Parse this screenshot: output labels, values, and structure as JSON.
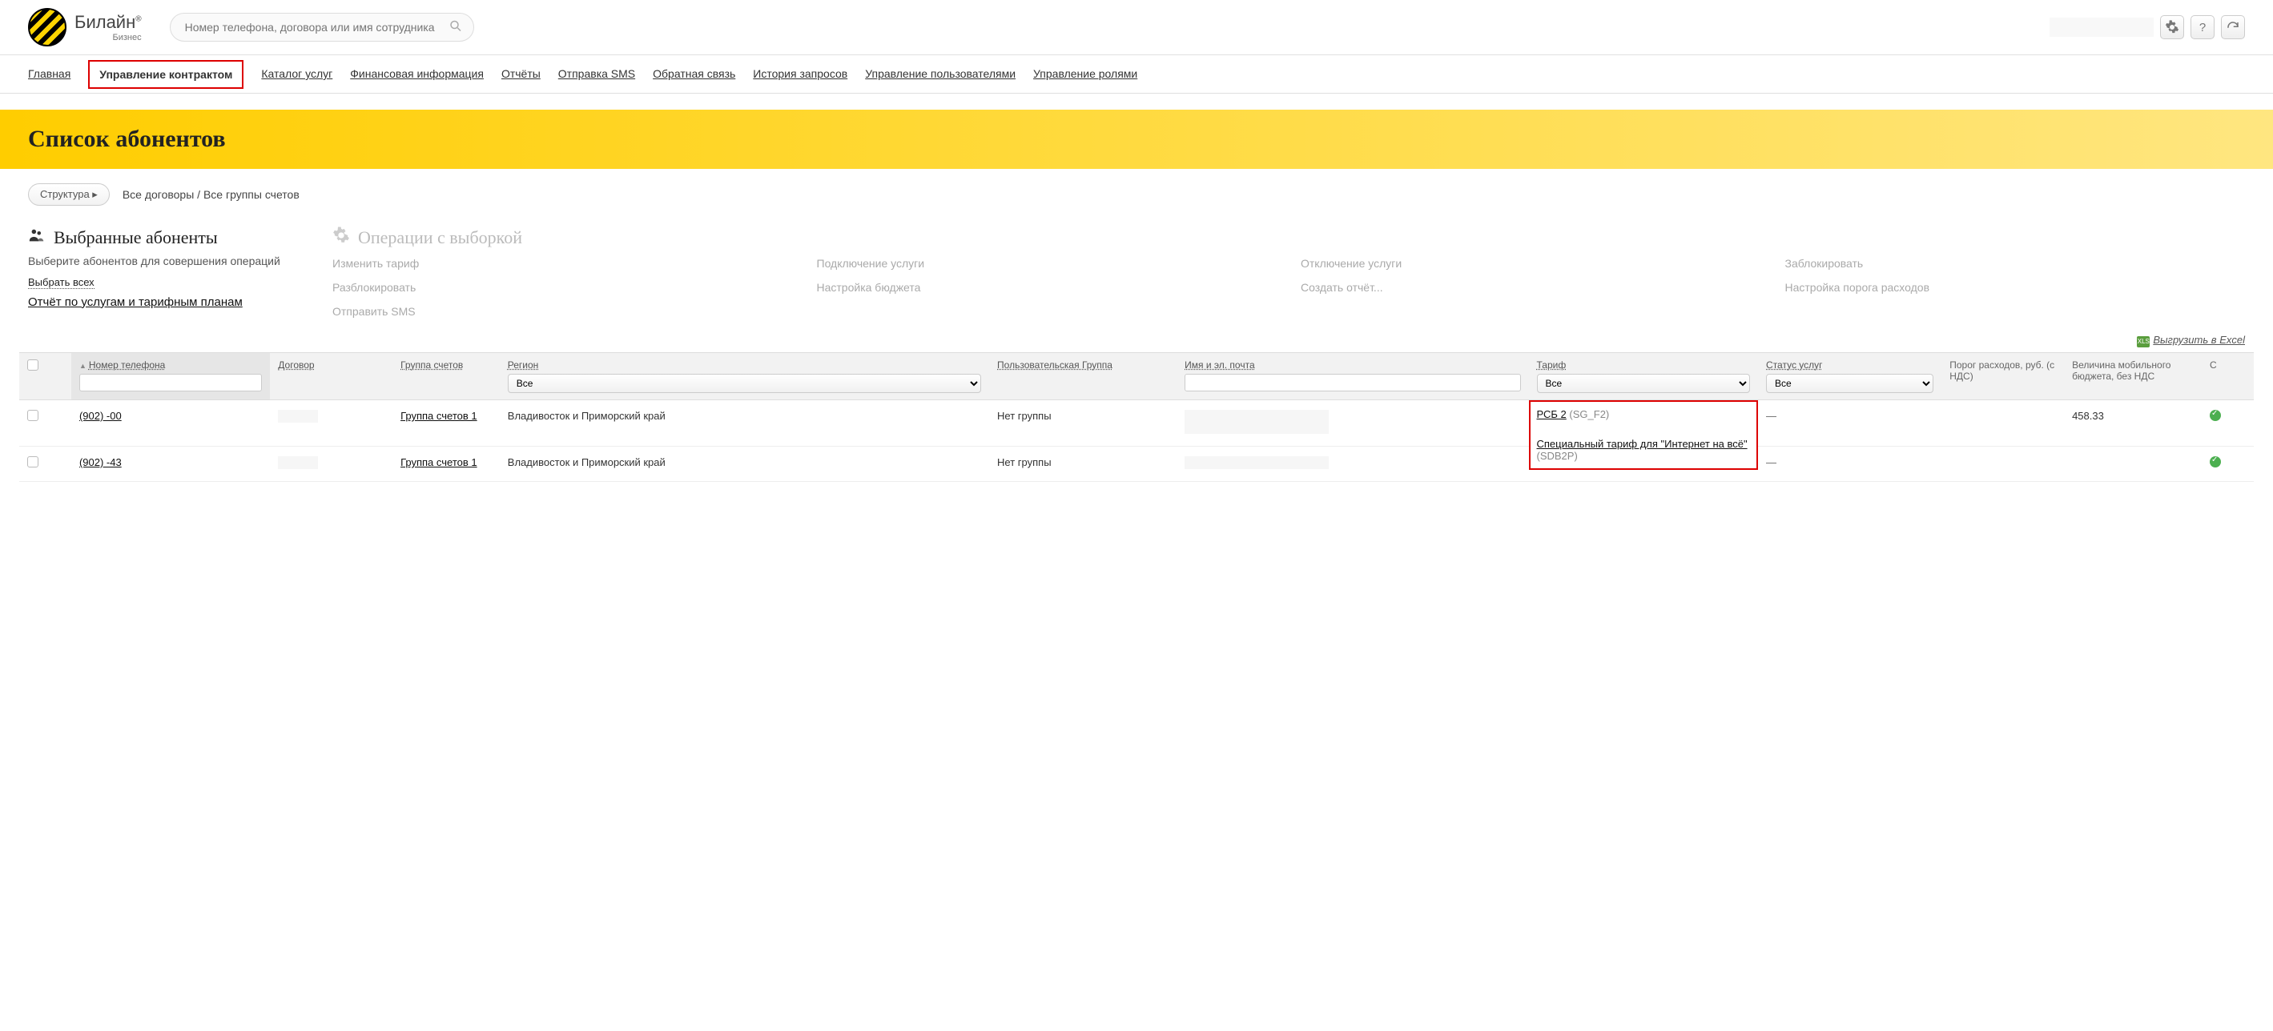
{
  "header": {
    "brand": "Билайн",
    "brand_sub": "Бизнес",
    "search_placeholder": "Номер телефона, договора или имя сотрудника"
  },
  "nav": {
    "items": [
      "Главная",
      "Управление контрактом",
      "Каталог услуг",
      "Финансовая информация",
      "Отчёты",
      "Отправка SMS",
      "Обратная связь",
      "История запросов",
      "Управление пользователями",
      "Управление ролями"
    ],
    "active_index": 1
  },
  "page": {
    "title": "Список абонентов",
    "structure_btn": "Структура ▸",
    "breadcrumb": "Все договоры  /  Все группы счетов"
  },
  "selection": {
    "title": "Выбранные абоненты",
    "desc": "Выберите абонентов для совершения операций",
    "select_all": "Выбрать всех",
    "report_link": "Отчёт по услугам и тарифным планам"
  },
  "operations": {
    "title": "Операции с выборкой",
    "items": [
      "Изменить тариф",
      "Подключение услуги",
      "Отключение услуги",
      "Заблокировать",
      "Разблокировать",
      "Настройка бюджета",
      "Создать отчёт...",
      "Настройка порога расходов",
      "Отправить SMS"
    ]
  },
  "export_label": "Выгрузить в Excel",
  "table": {
    "columns": {
      "phone": "Номер телефона",
      "contract": "Договор",
      "account_group": "Группа счетов",
      "region": "Регион",
      "user_group": "Пользовательская Группа",
      "name_email": "Имя и эл. почта",
      "tariff": "Тариф",
      "service_status": "Статус услуг",
      "spend_threshold": "Порог расходов, руб. (с НДС)",
      "budget": "Величина мобильного бюджета, без НДС",
      "last": "С"
    },
    "filter_all": "Все",
    "rows": [
      {
        "phone": "(902)          -00",
        "account_group": "Группа счетов 1",
        "region": "Владивосток и Приморский край",
        "user_group": "Нет группы",
        "tariff_name": "РСБ 2",
        "tariff_code": "(SG_F2)",
        "service_status": "—",
        "budget": "458.33"
      },
      {
        "phone": "(902)          -43",
        "account_group": "Группа счетов 1",
        "region": "Владивосток и Приморский край",
        "user_group": "Нет группы",
        "tariff_name": "Специальный тариф для \"Интернет на всё\"",
        "tariff_code": "(SDB2P)",
        "service_status": "—",
        "budget": ""
      }
    ]
  }
}
